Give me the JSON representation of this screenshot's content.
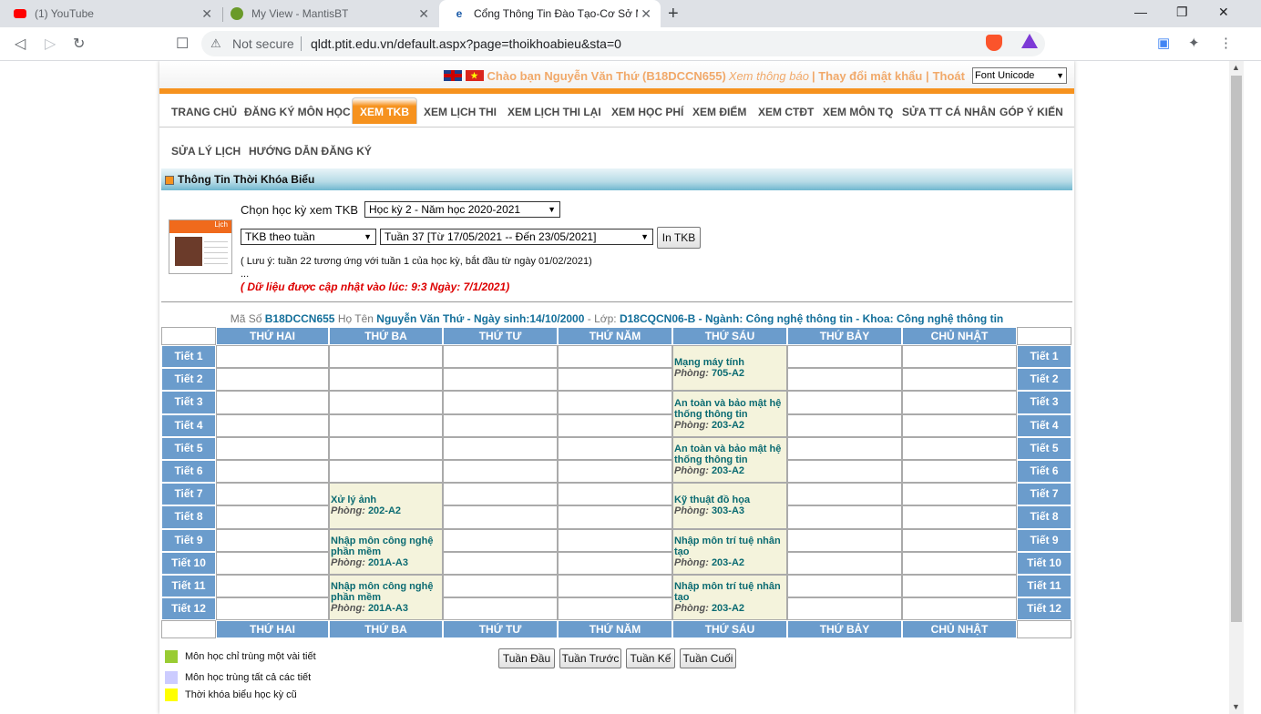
{
  "browser": {
    "tabs": [
      {
        "title": "(1) YouTube",
        "icon": "youtube-icon"
      },
      {
        "title": "My View - MantisBT",
        "icon": "mantis-icon"
      },
      {
        "title": "Cổng Thông Tin Đào Tạo-Cơ Sở M",
        "icon": "ptit-icon"
      }
    ],
    "security_label": "Not secure",
    "url": "qldt.ptit.edu.vn/default.aspx?page=thoikhoabieu&sta=0"
  },
  "header": {
    "greeting": "Chào bạn Nguyễn Văn Thứ (B18DCCN655)",
    "notice_link": "Xem thông báo",
    "change_password": "| Thay đổi mật khẩu |",
    "logout": "Thoát",
    "font_select": "Font Unicode"
  },
  "menu": {
    "items": [
      "TRANG CHỦ",
      "ĐĂNG KÝ MÔN HỌC",
      "XEM TKB",
      "XEM LỊCH THI",
      "XEM LỊCH THI LẠI",
      "XEM HỌC PHÍ",
      "XEM ĐIỂM",
      "XEM CTĐT",
      "XEM MÔN TQ",
      "SỬA TT CÁ NHÂN",
      "GÓP Ý KIẾN"
    ],
    "active": "XEM TKB",
    "row2": [
      "SỬA LÝ LỊCH",
      "HƯỚNG DẪN ĐĂNG KÝ"
    ]
  },
  "section_title": "Thông Tin Thời Khóa Biểu",
  "calendar_icon_label": "Lịch",
  "form": {
    "semester_label": "Chọn học kỳ xem TKB",
    "semester_value": "Học kỳ 2 - Năm học 2020-2021",
    "view_mode": "TKB theo tuần",
    "week_value": "Tuần 37 [Từ 17/05/2021 -- Đến 23/05/2021]",
    "print_button": "In TKB",
    "note": "( Lưu ý: tuần 22 tương ứng với tuần 1 của học kỳ, bắt đầu từ ngày 01/02/2021)",
    "ellipsis": "...",
    "update": "( Dữ liệu được cập nhật vào lúc: 9:3 Ngày: 7/1/2021)"
  },
  "student": {
    "id_label": "Mã Số",
    "id": "B18DCCN655",
    "name_label": "Họ Tên",
    "name": "Nguyễn Văn Thứ - Ngày sinh:14/10/2000",
    "class_label": "- Lớp:",
    "class_info": "D18CQCN06-B - Ngành: Công nghệ thông tin - Khoa: Công nghệ thông tin"
  },
  "timetable": {
    "days": [
      "THỨ HAI",
      "THỨ BA",
      "THỨ TƯ",
      "THỨ NĂM",
      "THỨ SÁU",
      "THỨ BẢY",
      "CHỦ NHẬT"
    ],
    "periods": [
      "Tiết 1",
      "Tiết 2",
      "Tiết 3",
      "Tiết 4",
      "Tiết 5",
      "Tiết 6",
      "Tiết 7",
      "Tiết 8",
      "Tiết 9",
      "Tiết 10",
      "Tiết 11",
      "Tiết 12"
    ],
    "room_label": "Phòng:",
    "courses": [
      {
        "day": 4,
        "start": 1,
        "span": 2,
        "name": "Mạng máy tính",
        "room": "705-A2"
      },
      {
        "day": 4,
        "start": 3,
        "span": 2,
        "name": "An toàn và bảo mật hệ thống thông tin",
        "room": "203-A2"
      },
      {
        "day": 4,
        "start": 5,
        "span": 2,
        "name": "An toàn và bảo mật hệ thống thông tin",
        "room": "203-A2"
      },
      {
        "day": 1,
        "start": 7,
        "span": 2,
        "name": "Xử lý ảnh",
        "room": "202-A2"
      },
      {
        "day": 4,
        "start": 7,
        "span": 2,
        "name": "Kỹ thuật đồ họa",
        "room": "303-A3"
      },
      {
        "day": 1,
        "start": 9,
        "span": 2,
        "name": "Nhập môn công nghệ phần mềm",
        "room": "201A-A3"
      },
      {
        "day": 4,
        "start": 9,
        "span": 2,
        "name": "Nhập môn trí tuệ nhân tạo",
        "room": "203-A2"
      },
      {
        "day": 1,
        "start": 11,
        "span": 2,
        "name": "Nhập môn công nghệ phần mềm",
        "room": "201A-A3"
      },
      {
        "day": 4,
        "start": 11,
        "span": 2,
        "name": "Nhập môn trí tuệ nhân tạo",
        "room": "203-A2"
      }
    ]
  },
  "nav_buttons": [
    "Tuần Đầu",
    "Tuần Trước",
    "Tuần Kế",
    "Tuần Cuối"
  ],
  "legend": [
    {
      "label": "Môn học chỉ trùng một vài tiết",
      "color": "#99cc33"
    },
    {
      "label": "Môn học trùng tất cả các tiết",
      "color": "#ccccff"
    },
    {
      "label": "Thời khóa biểu học kỳ cũ",
      "color": "#ffff00"
    }
  ]
}
